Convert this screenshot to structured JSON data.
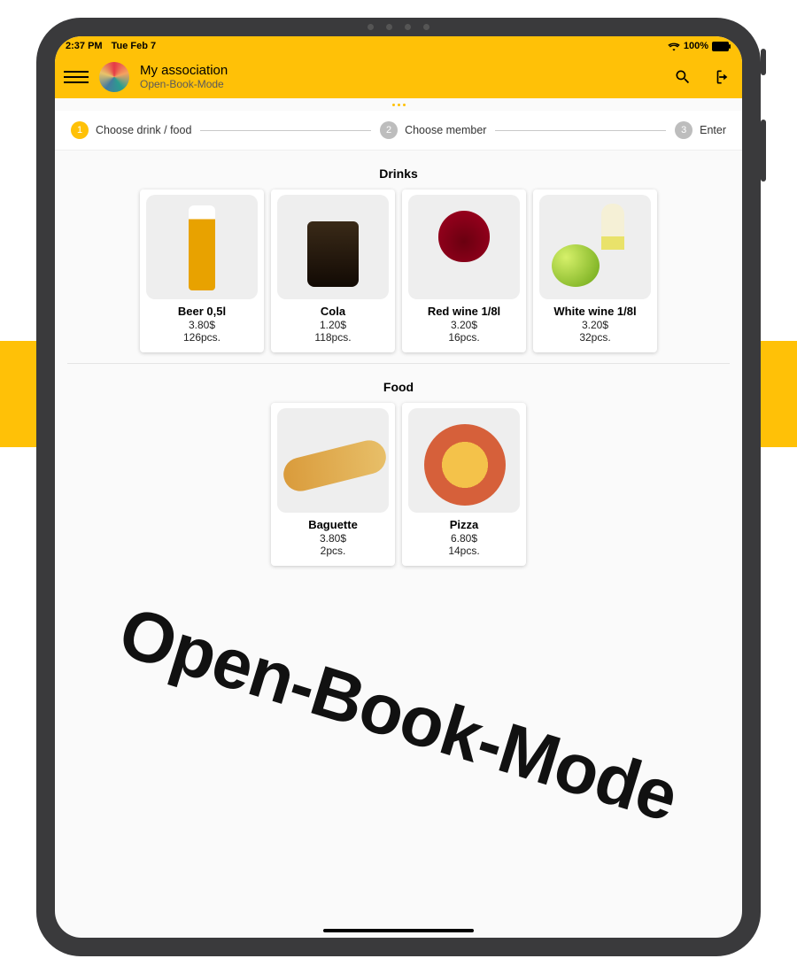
{
  "statusbar": {
    "time": "2:37 PM",
    "date": "Tue Feb 7",
    "battery": "100%"
  },
  "header": {
    "title": "My association",
    "subtitle": "Open-Book-Mode"
  },
  "stepper": {
    "steps": [
      {
        "num": "1",
        "label": "Choose drink / food",
        "active": true
      },
      {
        "num": "2",
        "label": "Choose member",
        "active": false
      },
      {
        "num": "3",
        "label": "Enter",
        "active": false
      }
    ]
  },
  "sections": [
    {
      "title": "Drinks",
      "items": [
        {
          "name": "Beer 0,5l",
          "price": "3.80$",
          "stock": "126pcs.",
          "art": "beer"
        },
        {
          "name": "Cola",
          "price": "1.20$",
          "stock": "118pcs.",
          "art": "cola"
        },
        {
          "name": "Red wine 1/8l",
          "price": "3.20$",
          "stock": "16pcs.",
          "art": "redwine"
        },
        {
          "name": "White wine 1/8l",
          "price": "3.20$",
          "stock": "32pcs.",
          "art": "whitewine"
        }
      ]
    },
    {
      "title": "Food",
      "items": [
        {
          "name": "Baguette",
          "price": "3.80$",
          "stock": "2pcs.",
          "art": "baguette"
        },
        {
          "name": "Pizza",
          "price": "6.80$",
          "stock": "14pcs.",
          "art": "pizza"
        }
      ]
    }
  ],
  "watermark": "Open-Book-Mode"
}
